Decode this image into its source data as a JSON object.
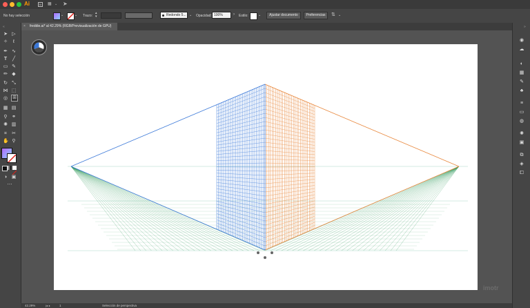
{
  "app": {
    "logo": "Ai"
  },
  "control": {
    "selection": "No hay selección",
    "stroke_label": "Trazo:",
    "brush_value": "Redondo 5...",
    "opacity_label": "Opacidad:",
    "opacity_value": "100%",
    "style_label": "Estilo:",
    "align_button": "Ajustar documento",
    "prefs_button": "Preferencias"
  },
  "tab": {
    "title": "freddie.ai* al 42.29% (RGB/Previsualización de GPU)",
    "close": "×"
  },
  "status": {
    "zoom": "42.29%",
    "page": "1",
    "tool": "Selección de perspectiva"
  },
  "watermark": "imotr",
  "colors": {
    "left_grid": "#3a78d8",
    "right_grid": "#e8863a",
    "floor_grid": "#2e9a5a",
    "horizon": "#a8d8c8"
  },
  "icons": {
    "left": [
      "selection-icon",
      "direct-select-icon",
      "magic-wand-icon",
      "lasso-icon",
      "pen-icon",
      "curvature-icon",
      "type-icon",
      "line-icon",
      "rectangle-icon",
      "paintbrush-icon",
      "pencil-icon",
      "eraser-icon",
      "rotate-icon",
      "scale-icon",
      "width-icon",
      "free-transform-icon",
      "shape-builder-icon",
      "perspective-grid-icon",
      "mesh-icon",
      "gradient-icon",
      "eyedropper-icon",
      "blend-icon",
      "symbol-sprayer-icon",
      "column-graph-icon",
      "artboard-icon",
      "slice-icon",
      "hand-icon",
      "zoom-icon"
    ],
    "right": [
      "properties-icon",
      "libraries-icon",
      "color-icon",
      "swatches-icon",
      "brushes-icon",
      "symbols-icon",
      "stroke-icon",
      "gradient-panel-icon",
      "transparency-icon",
      "appearance-icon",
      "graphic-styles-icon",
      "layers-icon",
      "artboards-icon",
      "links-icon"
    ]
  }
}
